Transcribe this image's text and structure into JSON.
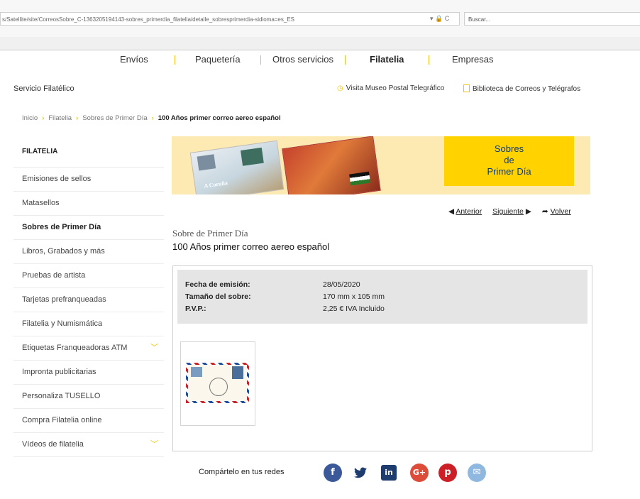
{
  "browser": {
    "url": "s/Satellite/site/CorreosSobre_C-1363205194143-sobres_primerdia_filatelia/detalle_sobresprimerdia-sidioma=es_ES",
    "url_icons": "▾ 🔒 C",
    "search_placeholder": "Buscar..."
  },
  "nav": {
    "items": [
      "Envíos",
      "Paquetería",
      "Otros servicios",
      "Filatelia",
      "Empresas"
    ],
    "active": "Filatelia"
  },
  "subheader": {
    "section": "Servicio Filatélico",
    "museo": "Visita Museo Postal Telegráfico",
    "biblioteca": "Biblioteca de Correos y Telégrafos"
  },
  "breadcrumb": [
    "Inicio",
    "Filatelia",
    "Sobres de Primer Día",
    "100 Años primer correo aereo español"
  ],
  "sidebar": {
    "heading": "FILATELIA",
    "items": [
      {
        "label": "Emisiones de sellos"
      },
      {
        "label": "Matasellos"
      },
      {
        "label": "Sobres de Primer Día"
      },
      {
        "label": "Libros, Grabados y más"
      },
      {
        "label": "Pruebas de artista"
      },
      {
        "label": "Tarjetas prefranqueadas"
      },
      {
        "label": "Filatelia y Numismática"
      },
      {
        "label": "Etiquetas Franqueadoras ATM"
      },
      {
        "label": "Impronta publicitarias"
      },
      {
        "label": "Personaliza TUSELLO"
      },
      {
        "label": "Compra Filatelia online"
      },
      {
        "label": "Vídeos de filatelia"
      }
    ]
  },
  "banner": {
    "title_line1": "Sobres",
    "title_line2": "de",
    "title_line3": "Primer Día",
    "card_text": "A Coruña"
  },
  "pager": {
    "prev": "Anterior",
    "next": "Siguiente",
    "back": "Volver"
  },
  "content": {
    "subtitle": "Sobre de Primer Día",
    "title": "100 Años primer correo aereo español",
    "fecha_label": "Fecha de emisión:",
    "fecha_value": "28/05/2020",
    "tamano_label": "Tamaño del sobre:",
    "tamano_value": "170 mm x 105 mm",
    "pvp_label": "P.V.P.:",
    "pvp_value": "2,25 € IVA Incluido"
  },
  "share": {
    "label": "Compártelo en tus redes",
    "networks": [
      {
        "name": "facebook",
        "glyph": "f",
        "color": "#3b5998"
      },
      {
        "name": "twitter",
        "glyph": "🐦",
        "color": "#1f3c6e"
      },
      {
        "name": "linkedin",
        "glyph": "in",
        "color": "#1f3c6e"
      },
      {
        "name": "google-plus",
        "glyph": "G+",
        "color": "#dd4b39"
      },
      {
        "name": "pinterest",
        "glyph": "p",
        "color": "#cb2027"
      },
      {
        "name": "email",
        "glyph": "✉",
        "color": "#8fb8e0"
      }
    ]
  }
}
